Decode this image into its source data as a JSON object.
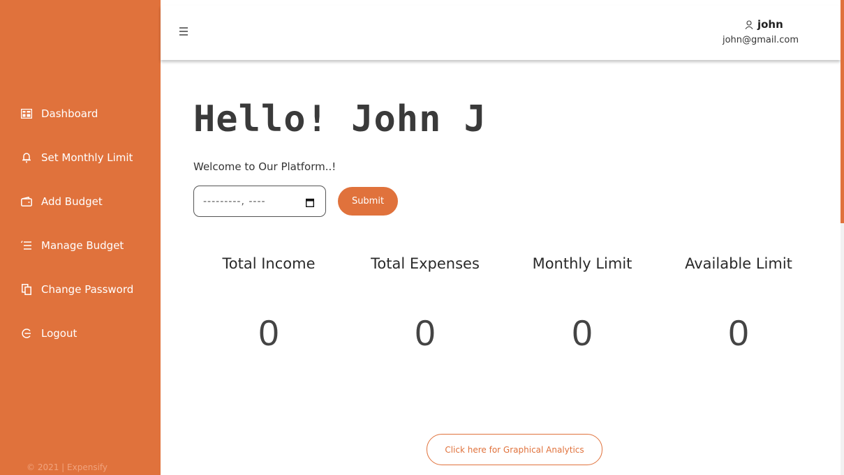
{
  "sidebar": {
    "items": [
      {
        "label": "Dashboard",
        "icon": "dashboard-icon"
      },
      {
        "label": "Set Monthly Limit",
        "icon": "bell-icon"
      },
      {
        "label": "Add Budget",
        "icon": "wallet-icon"
      },
      {
        "label": "Manage Budget",
        "icon": "list-icon"
      },
      {
        "label": "Change Password",
        "icon": "copy-icon"
      },
      {
        "label": "Logout",
        "icon": "logout-icon"
      }
    ],
    "footer": "© 2021 | Expensify"
  },
  "header": {
    "user_name": "john",
    "user_email": "john@gmail.com"
  },
  "main": {
    "greeting": "Hello! John J",
    "welcome": "Welcome to Our Platform..!",
    "date_value": "---------, ----",
    "submit_label": "Submit",
    "stats": [
      {
        "label": "Total Income",
        "value": "0"
      },
      {
        "label": "Total Expenses",
        "value": "0"
      },
      {
        "label": "Monthly Limit",
        "value": "0"
      },
      {
        "label": "Available Limit",
        "value": "0"
      }
    ],
    "analytics_label": "Click here for Graphical Analytics"
  },
  "colors": {
    "accent": "#e0723c",
    "sidebar_bg": "#e0723c",
    "text_dark": "#3a3a3a"
  }
}
